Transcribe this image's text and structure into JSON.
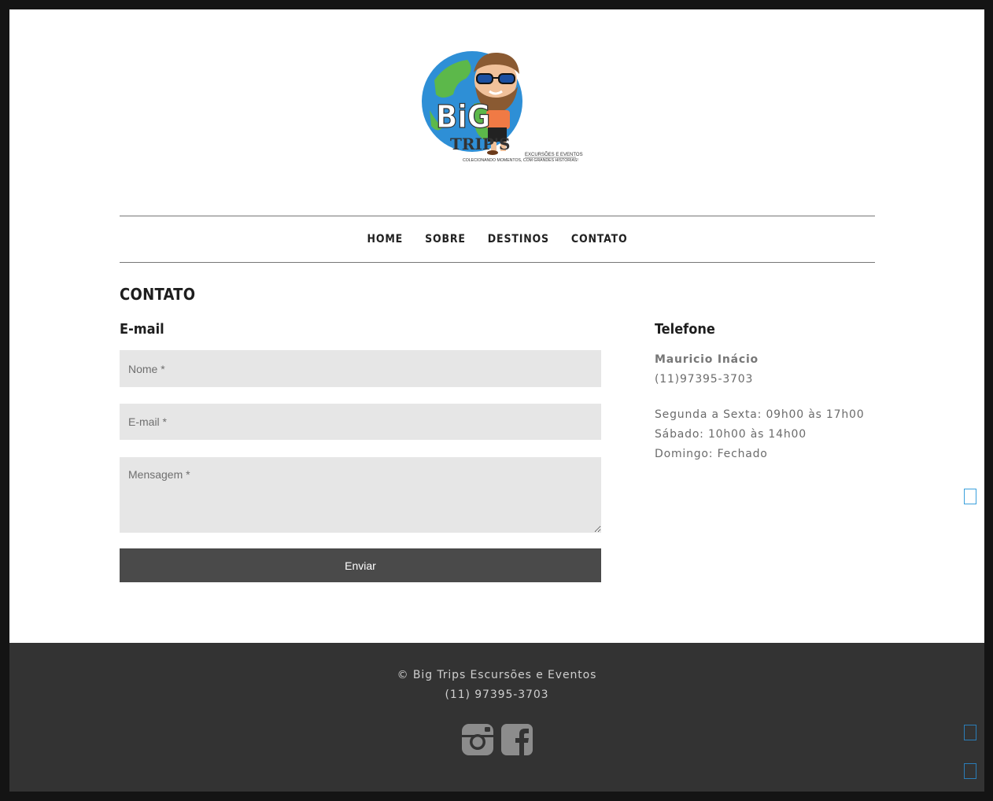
{
  "logo": {
    "brand_line1": "BiG",
    "brand_line2": "TRIP'S",
    "tagline1": "EXCURSÕES E EVENTOS",
    "tagline2": "COLECIONANDO MOMENTOS, COM GRANDES HISTORIAS!"
  },
  "nav": {
    "items": [
      {
        "label": "HOME"
      },
      {
        "label": "SOBRE"
      },
      {
        "label": "DESTINOS"
      },
      {
        "label": "CONTATO"
      }
    ]
  },
  "page": {
    "title": "CONTATO"
  },
  "form": {
    "heading": "E-mail",
    "name_placeholder": "Nome *",
    "email_placeholder": "E-mail *",
    "message_placeholder": "Mensagem *",
    "submit_label": "Enviar"
  },
  "phone_section": {
    "heading": "Telefone",
    "contact_name": "Mauricio Inácio",
    "phone": "(11)97395-3703",
    "hours": [
      "Segunda a Sexta: 09h00 às 17h00",
      "Sábado: 10h00 às 14h00",
      "Domingo: Fechado"
    ]
  },
  "footer": {
    "copyright": "© Big Trips Escursões e Eventos",
    "phone": "(11) 97395-3703",
    "social": [
      {
        "icon": "instagram-icon"
      },
      {
        "icon": "facebook-icon"
      }
    ]
  },
  "colors": {
    "footer_bg": "#333333",
    "field_bg": "#e6e6e6",
    "button_bg": "#4a4a4a",
    "accent_square": "#3aa0dc"
  }
}
